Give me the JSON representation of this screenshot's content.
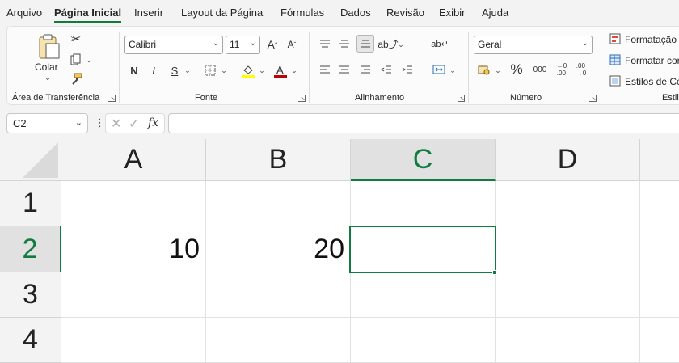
{
  "menu": {
    "tabs": [
      {
        "label": "Arquivo",
        "active": false
      },
      {
        "label": "Página Inicial",
        "active": true
      },
      {
        "label": "Inserir",
        "active": false
      },
      {
        "label": "Layout da Página",
        "active": false
      },
      {
        "label": "Fórmulas",
        "active": false
      },
      {
        "label": "Dados",
        "active": false
      },
      {
        "label": "Revisão",
        "active": false
      },
      {
        "label": "Exibir",
        "active": false
      },
      {
        "label": "Ajuda",
        "active": false
      }
    ]
  },
  "ribbon": {
    "clipboard": {
      "label": "Área de Transferência",
      "paste_label": "Colar"
    },
    "font": {
      "label": "Fonte",
      "font_name": "Calibri",
      "font_size": "11",
      "bold": "N",
      "italic": "I",
      "underline": "S"
    },
    "alignment": {
      "label": "Alinhamento"
    },
    "number": {
      "label": "Número",
      "format": "Geral",
      "percent": "%",
      "comma": "000"
    },
    "styles": {
      "label": "Estil",
      "conditional": "Formatação C",
      "as_table": "Formatar cor",
      "cell_styles": "Estilos de Cél"
    }
  },
  "formula_bar": {
    "name_box": "C2",
    "fx": "fx",
    "value": ""
  },
  "grid": {
    "columns": [
      "A",
      "B",
      "C",
      "D"
    ],
    "rows": [
      "1",
      "2",
      "3",
      "4"
    ],
    "selected_cell": "C2",
    "cells": {
      "A2": "10",
      "B2": "20"
    }
  },
  "colors": {
    "accent": "#107c41",
    "font_color": "#c00000",
    "highlight": "#ffff00"
  }
}
